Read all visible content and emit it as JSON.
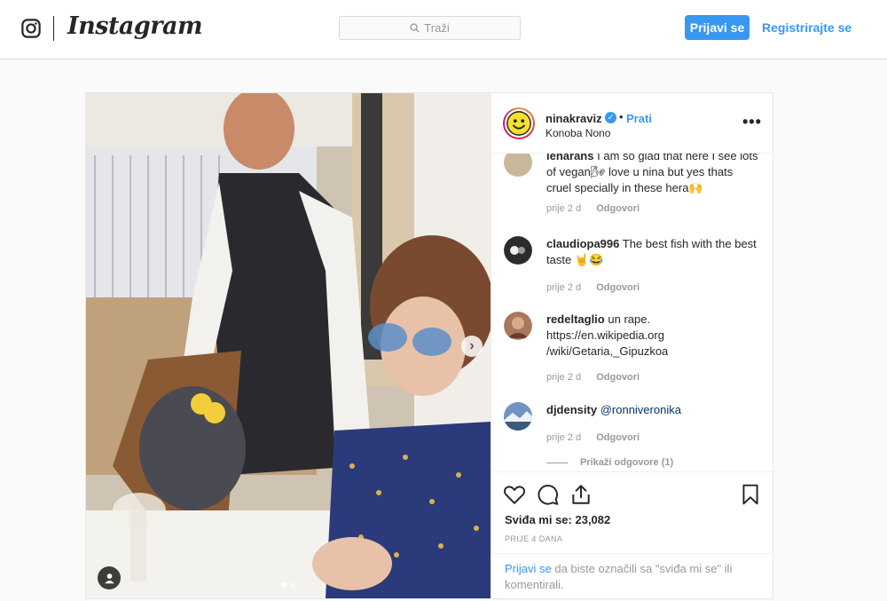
{
  "header": {
    "logo_text": "Instagram",
    "search_placeholder": "Traži",
    "login_label": "Prijavi se",
    "register_label": "Registrirajte se"
  },
  "post": {
    "username": "ninakraviz",
    "follow_label": "Prati",
    "bullet": "•",
    "location": "Konoba Nono",
    "comments": [
      {
        "user": "lenarans",
        "text": "I am so glad that here I see lots of vegan🌬 love u nina but yes thats cruel specially in these hera🙌",
        "time": "prije 2 d",
        "reply": "Odgovori"
      },
      {
        "user": "claudiopa996",
        "text": "The best fish with the best taste 🤘😂",
        "time": "prije 2 d",
        "reply": "Odgovori"
      },
      {
        "user": "redeltaglio",
        "text": "un rape. https://en.wikipedia.org /wiki/Getaria,_Gipuzkoa",
        "time": "prije 2 d",
        "reply": "Odgovori"
      },
      {
        "user": "djdensity",
        "mention": "@ronniveronika",
        "time": "prije 2 d",
        "reply": "Odgovori"
      }
    ],
    "view_replies": "Prikaži odgovore (1)",
    "likes": "Sviđa mi se: 23,082",
    "posted": "PRIJE 4 DANA",
    "login_link": "Prijavi se",
    "login_prompt_rest": " da biste označili sa \"sviđa mi se\" ili komentirali."
  },
  "colors": {
    "accent": "#3897f0",
    "border": "#dbdbdb",
    "muted": "#999999"
  },
  "icons": [
    "instagram-icon",
    "search-icon",
    "verified-icon",
    "more-icon",
    "chevron-right-icon",
    "user-tag-icon",
    "heart-icon",
    "comment-icon",
    "share-icon",
    "bookmark-icon"
  ]
}
